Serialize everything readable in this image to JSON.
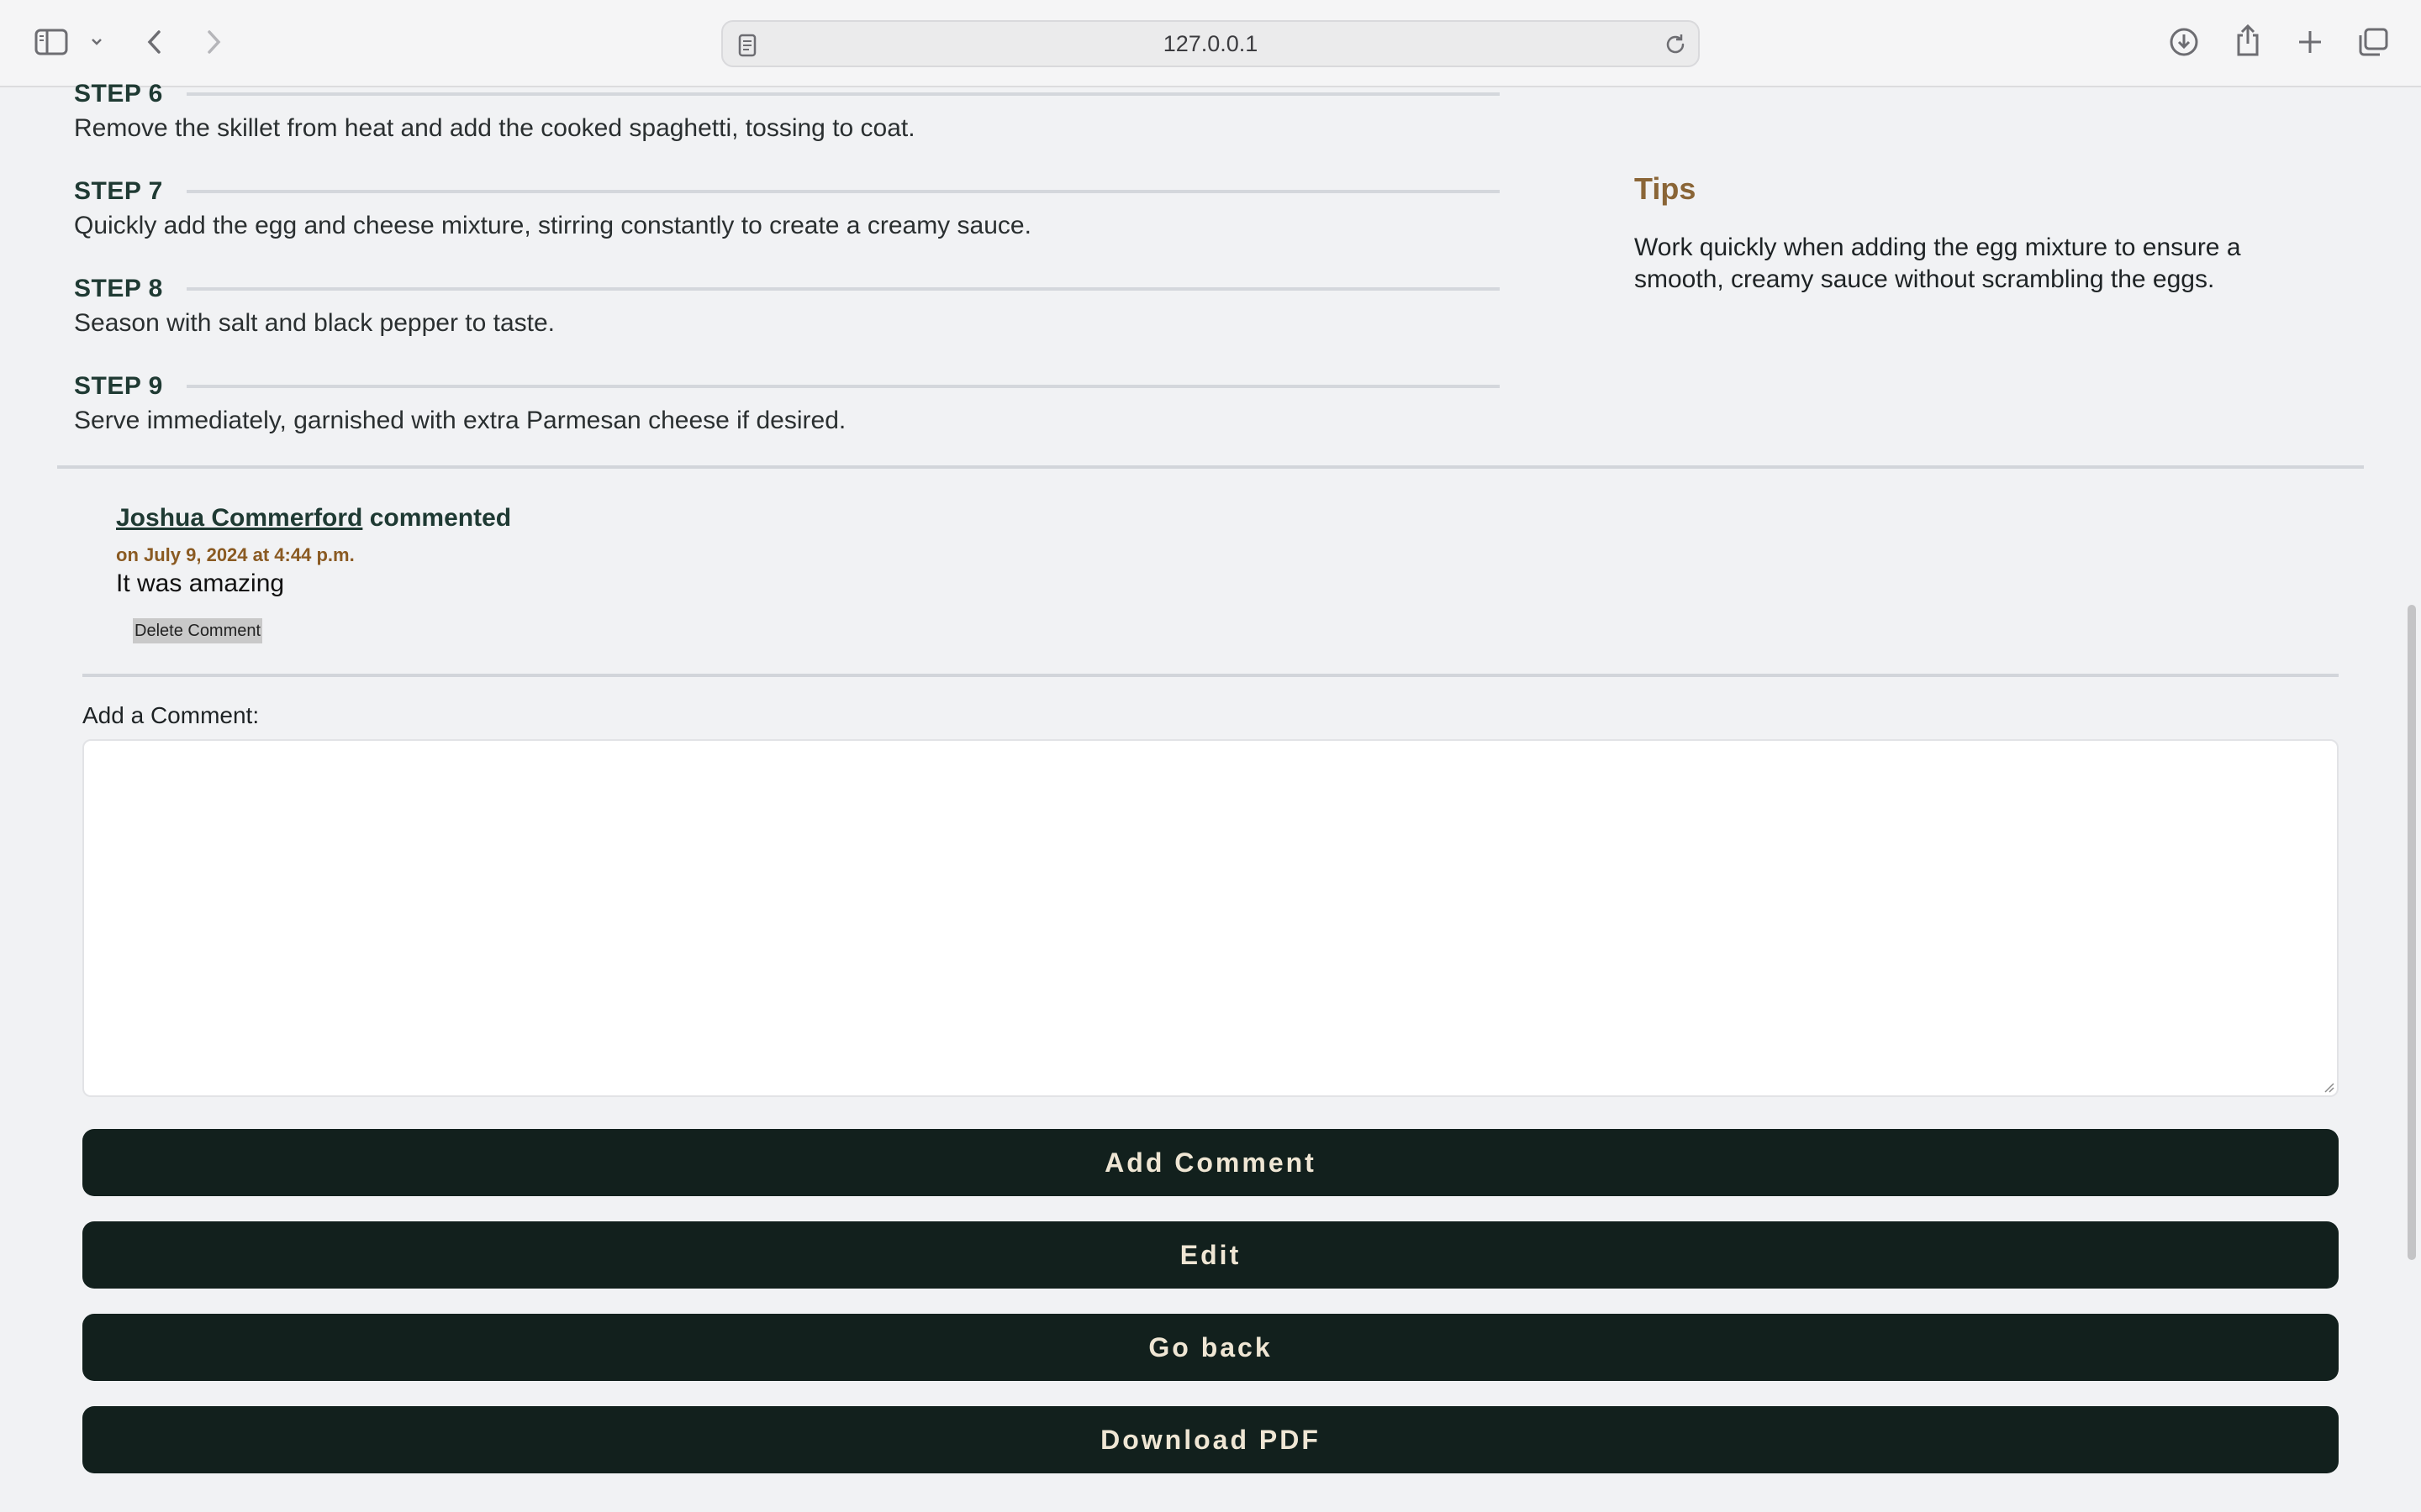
{
  "browser": {
    "url": "127.0.0.1",
    "icons": [
      "sidebar-icon",
      "chevron-down-icon",
      "back-icon",
      "forward-icon",
      "page-icon",
      "reload-icon",
      "download-icon",
      "share-icon",
      "plus-icon",
      "tabs-icon"
    ]
  },
  "steps": [
    {
      "label": "STEP 6",
      "text": "Remove the skillet from heat and add the cooked spaghetti, tossing to coat."
    },
    {
      "label": "STEP 7",
      "text": "Quickly add the egg and cheese mixture, stirring constantly to create a creamy sauce."
    },
    {
      "label": "STEP 8",
      "text": "Season with salt and black pepper to taste."
    },
    {
      "label": "STEP 9",
      "text": "Serve immediately, garnished with extra Parmesan cheese if desired."
    }
  ],
  "tips": {
    "title": "Tips",
    "text": "Work quickly when adding the egg mixture to ensure a smooth, creamy sauce without scrambling the eggs."
  },
  "comment": {
    "author": "Joshua Commerford",
    "verb": "commented",
    "date": "on July 9, 2024 at 4:44 p.m.",
    "body": "It was amazing",
    "delete_label": "Delete Comment"
  },
  "add_comment": {
    "label": "Add a Comment:",
    "value": "",
    "placeholder": ""
  },
  "buttons": {
    "add_comment": "Add Comment",
    "edit": "Edit",
    "go_back": "Go back",
    "download_pdf": "Download PDF"
  },
  "colors": {
    "background": "#f1f2f4",
    "button_bg": "#12201d",
    "button_text": "#efe6d4",
    "accent_brown": "#8a6536",
    "step_label": "#1f3a33"
  }
}
